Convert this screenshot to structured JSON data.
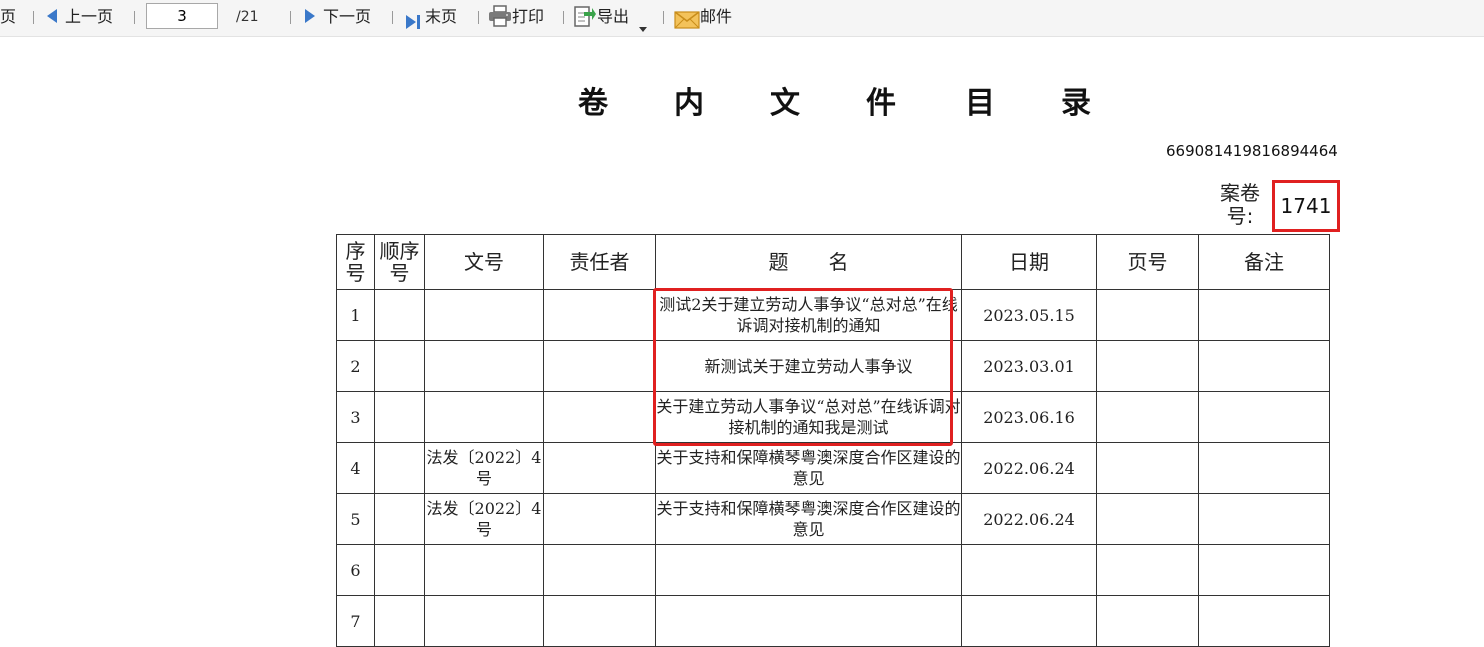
{
  "toolbar": {
    "first_page_label": "页",
    "prev_label": "上一页",
    "page_input_value": "3",
    "page_total": "/21",
    "next_label": "下一页",
    "last_label": "末页",
    "print_label": "打印",
    "export_label": "导出",
    "mail_label": "邮件"
  },
  "document": {
    "title_chars": [
      "卷",
      "内",
      "文",
      "件",
      "目",
      "录"
    ],
    "doc_id": "669081419816894464",
    "case_label": "案卷号:",
    "case_number": "1741"
  },
  "table": {
    "headers": [
      "序号",
      "顺序号",
      "文号",
      "责任者",
      "题　　名",
      "日期",
      "页号",
      "备注"
    ],
    "rows": [
      {
        "seq": "1",
        "order": "",
        "doc_no": "",
        "responsible": "",
        "title": "测试2关于建立劳动人事争议“总对总”在线诉调对接机制的通知",
        "date": "2023.05.15",
        "page": "",
        "note": ""
      },
      {
        "seq": "2",
        "order": "",
        "doc_no": "",
        "responsible": "",
        "title": "新测试关于建立劳动人事争议",
        "date": "2023.03.01",
        "page": "",
        "note": ""
      },
      {
        "seq": "3",
        "order": "",
        "doc_no": "",
        "responsible": "",
        "title": "关于建立劳动人事争议“总对总”在线诉调对接机制的通知我是测试",
        "date": "2023.06.16",
        "page": "",
        "note": ""
      },
      {
        "seq": "4",
        "order": "",
        "doc_no": "法发〔2022〕4 号",
        "responsible": "",
        "title": "关于支持和保障横琴粤澳深度合作区建设的意见",
        "date": "2022.06.24",
        "page": "",
        "note": ""
      },
      {
        "seq": "5",
        "order": "",
        "doc_no": "法发〔2022〕4 号",
        "responsible": "",
        "title": "关于支持和保障横琴粤澳深度合作区建设的意见",
        "date": "2022.06.24",
        "page": "",
        "note": ""
      },
      {
        "seq": "6",
        "order": "",
        "doc_no": "",
        "responsible": "",
        "title": "",
        "date": "",
        "page": "",
        "note": ""
      },
      {
        "seq": "7",
        "order": "",
        "doc_no": "",
        "responsible": "",
        "title": "",
        "date": "",
        "page": "",
        "note": ""
      }
    ]
  },
  "colors": {
    "highlight": "#e02020",
    "nav_arrow": "#3a78c9",
    "toolbar_bg": "#f5f5f5"
  },
  "icons": {
    "prev": "triangle-left-icon",
    "next": "triangle-right-icon",
    "last": "last-page-icon",
    "print": "printer-icon",
    "export": "export-icon",
    "mail": "envelope-icon"
  }
}
